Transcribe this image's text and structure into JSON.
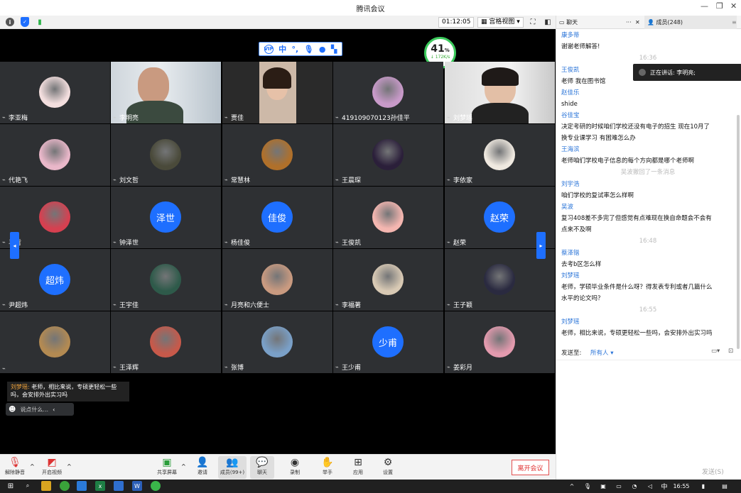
{
  "window": {
    "title": "腾讯会议"
  },
  "topbar": {
    "timer": "01:12:05",
    "view_label": "宫格视图"
  },
  "toolbar": {
    "zh_label": "中",
    "vip_label": "VIP"
  },
  "network": {
    "percent": "41",
    "percent_unit": "%",
    "speed": "↓ 172K/s"
  },
  "grid": {
    "tiles": [
      {
        "name": "李亚梅",
        "avatar_color": "#f3dede",
        "kind": "avatar"
      },
      {
        "name": "李明亮",
        "kind": "video",
        "video": "man"
      },
      {
        "name": "贾佳",
        "kind": "video",
        "video": "woman"
      },
      {
        "name": "419109070123孙佳平",
        "avatar_color": "#c89ac9",
        "kind": "avatar"
      },
      {
        "name": "刘梦瑶",
        "kind": "video",
        "video": "woman2"
      },
      {
        "name": "代艳飞",
        "avatar_color": "#e9b7c9",
        "kind": "avatar"
      },
      {
        "name": "刘文哲",
        "avatar_color": "#4a4a3a",
        "kind": "avatar"
      },
      {
        "name": "常慧林",
        "avatar_color": "#b0702a",
        "kind": "avatar"
      },
      {
        "name": "王晨琛",
        "avatar_color": "#2b1f3a",
        "kind": "avatar"
      },
      {
        "name": "李依家",
        "avatar_color": "#efe9e0",
        "kind": "avatar"
      },
      {
        "name": "马哲",
        "avatar_color": "#d64050",
        "kind": "avatar"
      },
      {
        "name": "钟泽世",
        "kind": "text",
        "avatar_text": "泽世"
      },
      {
        "name": "杨佳俊",
        "kind": "text",
        "avatar_text": "佳俊"
      },
      {
        "name": "王俊凯",
        "avatar_color": "#f4b6b0",
        "kind": "avatar"
      },
      {
        "name": "赵荣",
        "kind": "text",
        "avatar_text": "赵荣"
      },
      {
        "name": "尹超炜",
        "kind": "text",
        "avatar_text": "超炜"
      },
      {
        "name": "王宇佳",
        "avatar_color": "#2e5a4a",
        "kind": "avatar"
      },
      {
        "name": "月亮和六便士",
        "avatar_color": "#c99a80",
        "kind": "avatar"
      },
      {
        "name": "李福著",
        "avatar_color": "#d8c9b4",
        "kind": "avatar"
      },
      {
        "name": "王子颖",
        "avatar_color": "#2a2a40",
        "kind": "avatar"
      },
      {
        "name": "",
        "avatar_color": "#b38a52",
        "kind": "avatar"
      },
      {
        "name": "王泽辉",
        "avatar_color": "#c7594a",
        "kind": "avatar"
      },
      {
        "name": "张博",
        "avatar_color": "#7aa0c8",
        "kind": "avatar"
      },
      {
        "name": "王少甫",
        "kind": "text",
        "avatar_text": "少甫"
      },
      {
        "name": "姜彩月",
        "avatar_color": "#e39aae",
        "kind": "avatar"
      }
    ]
  },
  "danmu": {
    "who": "刘梦瑶:",
    "text": "老师，相比来说，专硕更轻松一些吗，会安排外出实习吗"
  },
  "say_placeholder": "说点什么...",
  "bottombar": {
    "mute": "解除静音",
    "video": "开启视频",
    "share": "共享屏幕",
    "invite": "邀请",
    "members": "成员(99+)",
    "chat": "聊天",
    "record": "录制",
    "hand": "举手",
    "apps": "应用",
    "settings": "设置",
    "leave": "离开会议"
  },
  "side": {
    "tab_chat": "聊天",
    "tab_members": "成员(248)",
    "toast": "正在讲话: 李明亮;",
    "send_to_label": "发送至:",
    "send_to_value": "所有人",
    "send_button": "发送(S)",
    "messages": [
      {
        "t": "name",
        "v": "康多蒂"
      },
      {
        "t": "body",
        "v": "谢谢老师解答!"
      },
      {
        "t": "time",
        "v": "16:36"
      },
      {
        "t": "name",
        "v": "王俊凯"
      },
      {
        "t": "body",
        "v": "老师 我在图书馆"
      },
      {
        "t": "name",
        "v": "赵佳乐"
      },
      {
        "t": "body",
        "v": "shide"
      },
      {
        "t": "name",
        "v": "谷佳宝"
      },
      {
        "t": "body",
        "v": "决定考研的时候咱们学校还没有电子的招生 现在10月了"
      },
      {
        "t": "body",
        "v": "换专业课学习 有困难怎么办"
      },
      {
        "t": "name",
        "v": "王海滨"
      },
      {
        "t": "body",
        "v": "老师咱们学校电子信息的每个方向都是哪个老师啊"
      },
      {
        "t": "time",
        "v": "吴波撤回了一条消息"
      },
      {
        "t": "name",
        "v": "刘宇浩"
      },
      {
        "t": "body",
        "v": "咱们学校的复试率怎么样啊"
      },
      {
        "t": "name",
        "v": "吴波"
      },
      {
        "t": "body",
        "v": "复习408差不多完了但感觉有点难现在换自命题会不会有"
      },
      {
        "t": "body",
        "v": "点来不及啊"
      },
      {
        "t": "time",
        "v": "16:48"
      },
      {
        "t": "name",
        "v": "蔡泽锴"
      },
      {
        "t": "body",
        "v": "去考b区怎么样"
      },
      {
        "t": "name",
        "v": "刘梦瑶"
      },
      {
        "t": "body",
        "v": "老师，学硕毕业条件是什么呀？得发表专利或者几篇什么"
      },
      {
        "t": "body",
        "v": "水平的论文吗？"
      },
      {
        "t": "time",
        "v": "16:55"
      },
      {
        "t": "name",
        "v": "刘梦瑶"
      },
      {
        "t": "body",
        "v": "老师，相比来说，专硕更轻松一些吗，会安排外出实习吗"
      }
    ]
  },
  "taskbar": {
    "ime": "中",
    "clock": "16:55"
  }
}
